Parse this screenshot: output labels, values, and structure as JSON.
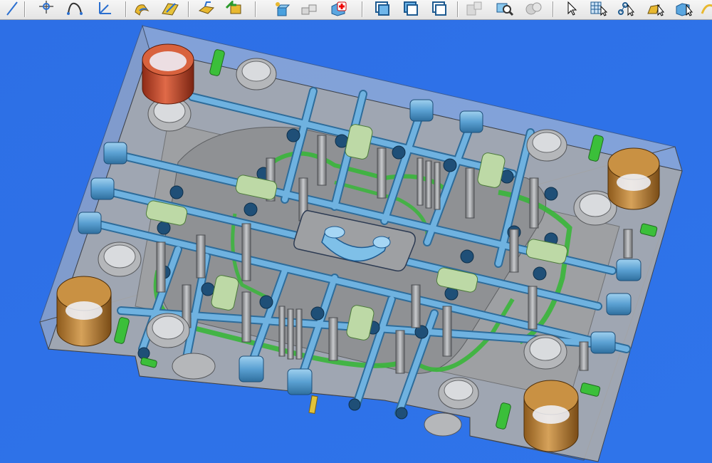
{
  "toolbar": {
    "buttons": [
      {
        "icon": "line-tool-icon"
      },
      {
        "icon": "point-snap-icon"
      },
      {
        "icon": "arc-tool-icon"
      },
      {
        "icon": "coordinate-axes-icon"
      },
      {
        "icon": "sweep-surface-icon"
      },
      {
        "icon": "ruled-surface-icon"
      },
      {
        "icon": "extrude-surface-icon"
      },
      {
        "icon": "move-object-icon"
      },
      {
        "icon": "insert-component-icon"
      },
      {
        "icon": "component-group-icon"
      },
      {
        "icon": "heal-solid-icon"
      },
      {
        "icon": "layer-front-icon"
      },
      {
        "icon": "layer-middle-icon"
      },
      {
        "icon": "layer-back-icon"
      },
      {
        "icon": "properties-disabled-icon"
      },
      {
        "icon": "zoom-find-icon"
      },
      {
        "icon": "render-settings-icon"
      },
      {
        "icon": "select-pointer-icon"
      },
      {
        "icon": "select-grid-icon"
      },
      {
        "icon": "select-nodes-icon"
      },
      {
        "icon": "select-faces-icon"
      },
      {
        "icon": "select-body-icon"
      },
      {
        "icon": "select-curve-icon"
      }
    ]
  },
  "scene": {
    "background_color": "#2d6fe6",
    "plate_color": "#a9abae",
    "cooling_channel_color": "#5da2d3",
    "ejector_pin_color": "#8a8c8f",
    "guide_bushing_color": "#b07a32",
    "highlight_bushing_color": "#c24a2a",
    "cavity_edge_color": "#38b63a",
    "support_insert_color": "#bdd9a6"
  }
}
